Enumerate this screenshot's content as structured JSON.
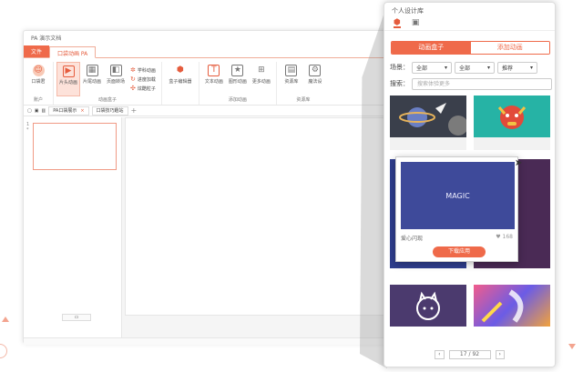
{
  "app": {
    "title": "PA 演示文档",
    "tabs": [
      "文件",
      "口袋动画 PA"
    ],
    "groups": [
      {
        "name": "账户",
        "buttons": [
          "口袋君"
        ]
      },
      {
        "name": "动画盒子",
        "buttons": [
          "片头动画",
          "片尾动画",
          "页面转场"
        ],
        "small": [
          "学科动画",
          "进度加载",
          "炫酷粒子"
        ]
      },
      {
        "name": "",
        "buttons": [
          "盒子编辑器"
        ]
      },
      {
        "name": "添加动画",
        "buttons": [
          "文本动画",
          "图形动画",
          "更多动画"
        ]
      },
      {
        "name": "资源库",
        "buttons": [
          "资源库",
          "魔法设"
        ]
      }
    ],
    "doc_tabs": [
      "PA口袋展示",
      "口袋技巧趣站"
    ],
    "slide_numbers": [
      "1",
      "*"
    ]
  },
  "library": {
    "title": "个人设计库",
    "segments": [
      "动画盒子",
      "添加动画"
    ],
    "filter_label": "场景：",
    "filters": [
      "全部",
      "全部",
      "推荐"
    ],
    "search_label": "搜索：",
    "search_placeholder": "搜索体验更多",
    "popup": {
      "thumb_text": "MAGIC",
      "name": "爱心闪现",
      "likes": "168",
      "button": "下载应用"
    },
    "pager": {
      "current": "17",
      "sep": "/",
      "total": "92"
    }
  }
}
